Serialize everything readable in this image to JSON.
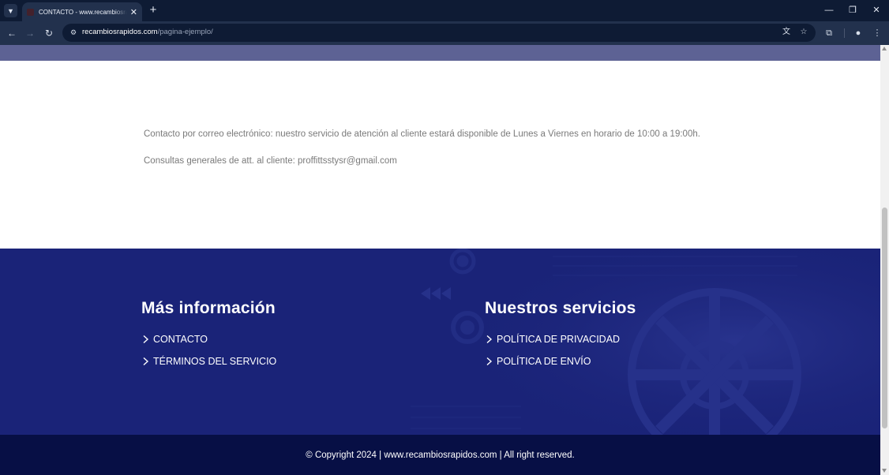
{
  "browser": {
    "tab_title": "CONTACTO - www.recambiosrapidos.com",
    "new_tab_symbol": "+",
    "url_domain": "recambiosrapidos.com",
    "url_path": "/pagina-ejemplo/"
  },
  "icons": {
    "tab_search": "chevron-down-icon",
    "tab_close": "close-icon",
    "new_tab": "plus-icon",
    "back": "arrow-left-icon",
    "forward": "arrow-right-icon",
    "reload": "reload-icon",
    "site_info": "tune-icon",
    "translate": "translate-icon",
    "bookmark": "star-icon",
    "screenshot": "capture-icon",
    "profile": "person-icon",
    "menu": "kebab-icon",
    "minimize": "minimize-icon",
    "restore": "restore-icon",
    "close_window": "close-icon",
    "footer_link": "chevron-right-icon"
  },
  "contact": {
    "line1": "Contacto por correo electrónico: nuestro servicio de atención al cliente estará disponible de Lunes a Viernes en horario de 10:00 a 19:00h.",
    "line2": "Consultas generales de att. al cliente: proffittsstysr@gmail.com"
  },
  "footer": {
    "left": {
      "heading": "Más información",
      "links": [
        "CONTACTO",
        "TÉRMINOS DEL SERVICIO"
      ]
    },
    "right": {
      "heading": "Nuestros servicios",
      "links": [
        "POLÍTICA DE PRIVACIDAD",
        "POLÍTICA DE ENVÍO"
      ]
    },
    "copyright": "© Copyright 2024 | www.recambiosrapidos.com | All right reserved."
  },
  "colors": {
    "chrome_dark": "#0e1b34",
    "chrome_toolbar": "#22314d",
    "hero_band": "#5d6294",
    "body_text": "#7a7a7a",
    "footer_bg": "#1a2378",
    "copyright_bg": "#070f45"
  }
}
